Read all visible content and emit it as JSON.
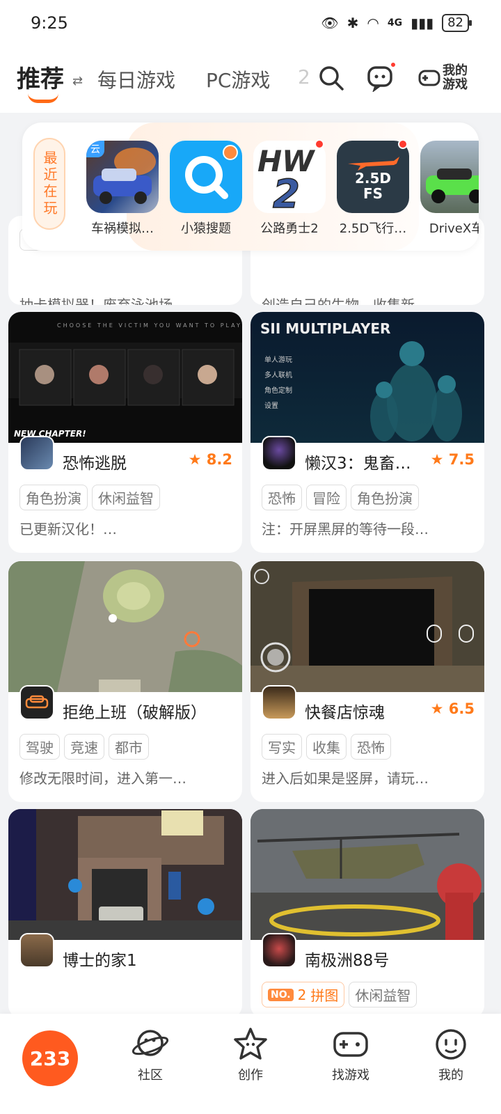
{
  "status": {
    "time": "9:25",
    "network": "4G",
    "battery": "82"
  },
  "topnav": {
    "active_tab": "推荐",
    "tabs": [
      "每日游戏",
      "PC游戏",
      "2"
    ],
    "my_games_label": "我的游戏"
  },
  "recent": {
    "label": "最近在玩",
    "items": [
      {
        "name": "车祸模拟…",
        "badge": "云",
        "icon": "car-crash-game-icon"
      },
      {
        "name": "小猿搜题",
        "icon": "search-app-icon"
      },
      {
        "name": "公路勇士2",
        "icon": "hw2-game-icon"
      },
      {
        "name": "2.5D飞行…",
        "icon": "flight-sim-icon",
        "icon_text": "2.5D FS"
      },
      {
        "name": "DriveX车",
        "icon": "drivex-game-icon"
      }
    ]
  },
  "partial_cards": [
    {
      "desc": "抽卡模拟器！废弃泳池场…"
    },
    {
      "desc": "创造自己的生物，收集新…"
    }
  ],
  "cards": [
    {
      "name": "恐怖逃脱",
      "rating": "8.2",
      "tags": [
        "角色扮演",
        "休闲益智"
      ],
      "desc": "已更新汉化！…",
      "shot_text": "NEW CHAPTER!"
    },
    {
      "name": "懒汉3：鬼畜…",
      "rating": "7.5",
      "tags": [
        "恐怖",
        "冒险",
        "角色扮演"
      ],
      "desc": "注：开屏黑屏的等待一段…",
      "shot_text": "SII MULTIPLAYER"
    },
    {
      "name": "拒绝上班（破解版）",
      "rating": "",
      "tags": [
        "驾驶",
        "竞速",
        "都市"
      ],
      "desc": "修改无限时间，进入第一…"
    },
    {
      "name": "快餐店惊魂",
      "rating": "6.5",
      "tags": [
        "写实",
        "收集",
        "恐怖"
      ],
      "desc": "进入后如果是竖屏，请玩…"
    },
    {
      "name": "博士的家1",
      "rating": "",
      "tags": [],
      "desc": ""
    },
    {
      "name": "南极洲88号",
      "rating": "",
      "rank_badge": "NO.",
      "rank": "2",
      "rank_tag": "拼图",
      "tags": [
        "休闲益智"
      ],
      "desc": ""
    }
  ],
  "bottomnav": {
    "home": "233",
    "items": [
      "社区",
      "创作",
      "找游戏",
      "我的"
    ]
  },
  "colors": {
    "accent": "#ff6a16",
    "rating": "#ff7a1a"
  }
}
